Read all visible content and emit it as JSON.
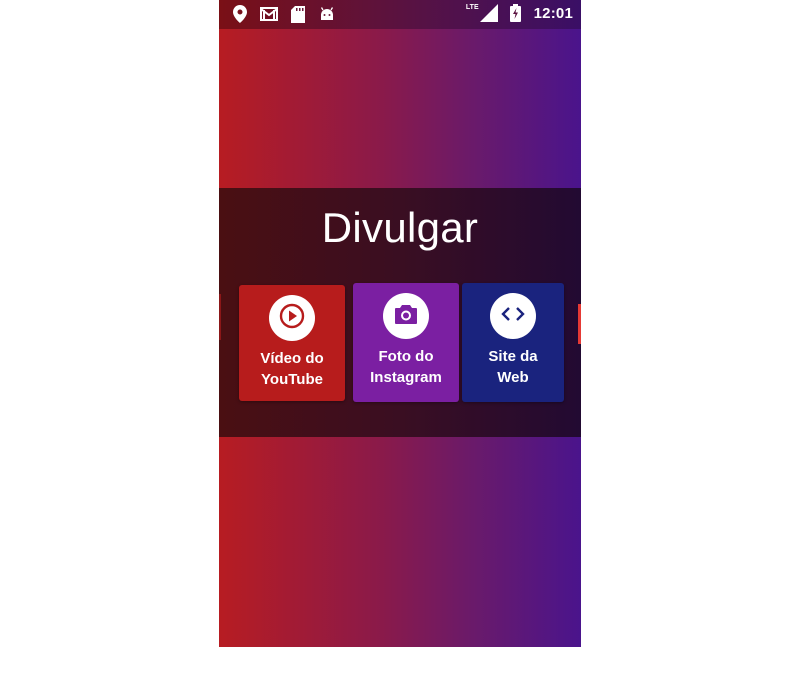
{
  "statusbar": {
    "left_icons": [
      "location-icon",
      "gmail-icon",
      "sd-card-icon",
      "android-icon"
    ],
    "network": "LTE",
    "time": "12:01"
  },
  "main": {
    "title": "Divulgar",
    "cards": [
      {
        "label": "Vídeo do\nYouTube",
        "icon": "play-icon",
        "color": "#b71c1c"
      },
      {
        "label": "Foto do\nInstagram",
        "icon": "camera-icon",
        "color": "#7b1fa2"
      },
      {
        "label": "Site da\nWeb",
        "icon": "code-icon",
        "color": "#1a237e"
      }
    ]
  },
  "colors": {
    "gradient_start": "#b71c22",
    "gradient_end": "#4a148c"
  }
}
